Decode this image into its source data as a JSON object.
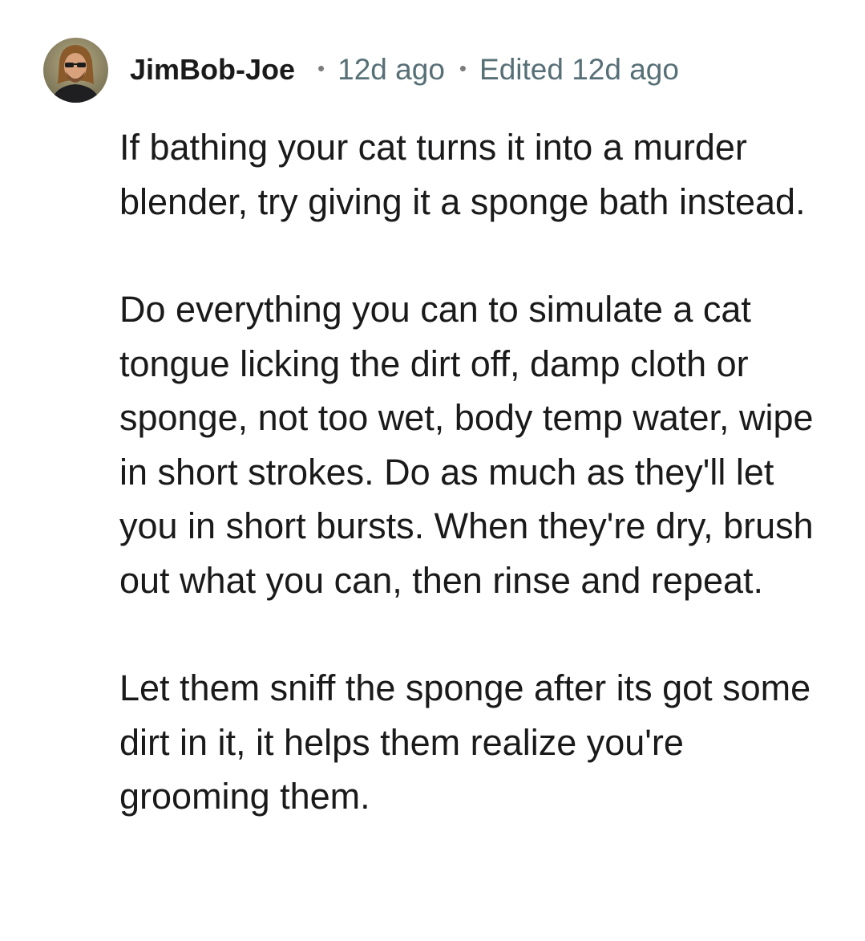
{
  "comment": {
    "author": "JimBob-Joe",
    "separator": "•",
    "posted": "12d ago",
    "edited": "Edited 12d ago",
    "avatar_icon": "user-avatar-photo",
    "paragraphs": [
      "If bathing your cat turns it into a murder blender, try giving it a sponge bath instead.",
      "Do everything you can to simulate a cat tongue licking the dirt off, damp cloth or sponge, not too wet, body temp water, wipe in short strokes. Do as much as they'll let you in short bursts. When they're dry, brush out what you can, then rinse and repeat.",
      "Let them sniff the sponge after its got some dirt in it, it helps them realize you're grooming them."
    ]
  },
  "colors": {
    "text": "#1a1a1b",
    "meta": "#576f76",
    "background": "#ffffff"
  }
}
